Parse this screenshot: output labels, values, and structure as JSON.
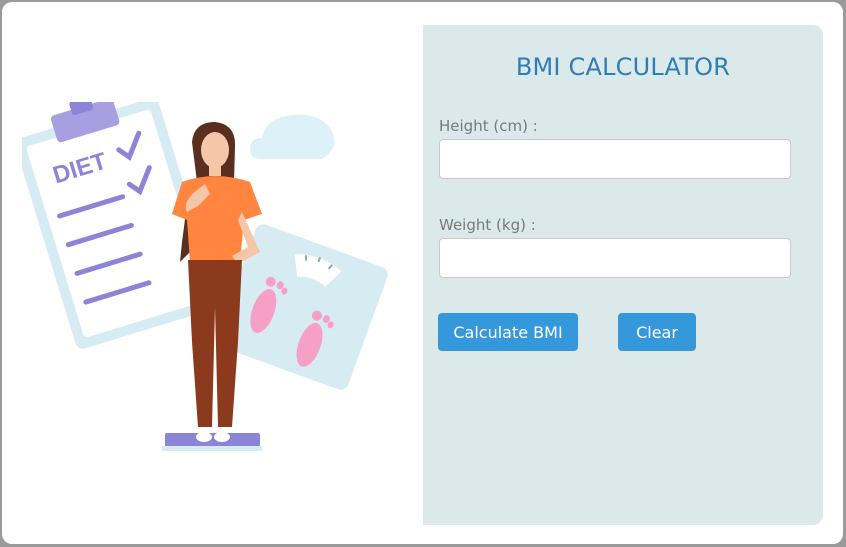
{
  "app": {
    "title": "BMI CALCULATOR"
  },
  "form": {
    "height_label": "Height (cm) :",
    "height_value": "",
    "weight_label": "Weight (kg) :",
    "weight_value": "",
    "calculate_label": "Calculate BMI",
    "clear_label": "Clear"
  },
  "illustration": {
    "clipboard_text": "DIET"
  },
  "colors": {
    "panel_bg": "#dbe9eb",
    "title": "#2e7db9",
    "button": "#3498db",
    "shirt": "#ff8540",
    "pants": "#8c3a1e",
    "diet_purple": "#8c84d6",
    "feet_pink": "#f6a0c6"
  }
}
